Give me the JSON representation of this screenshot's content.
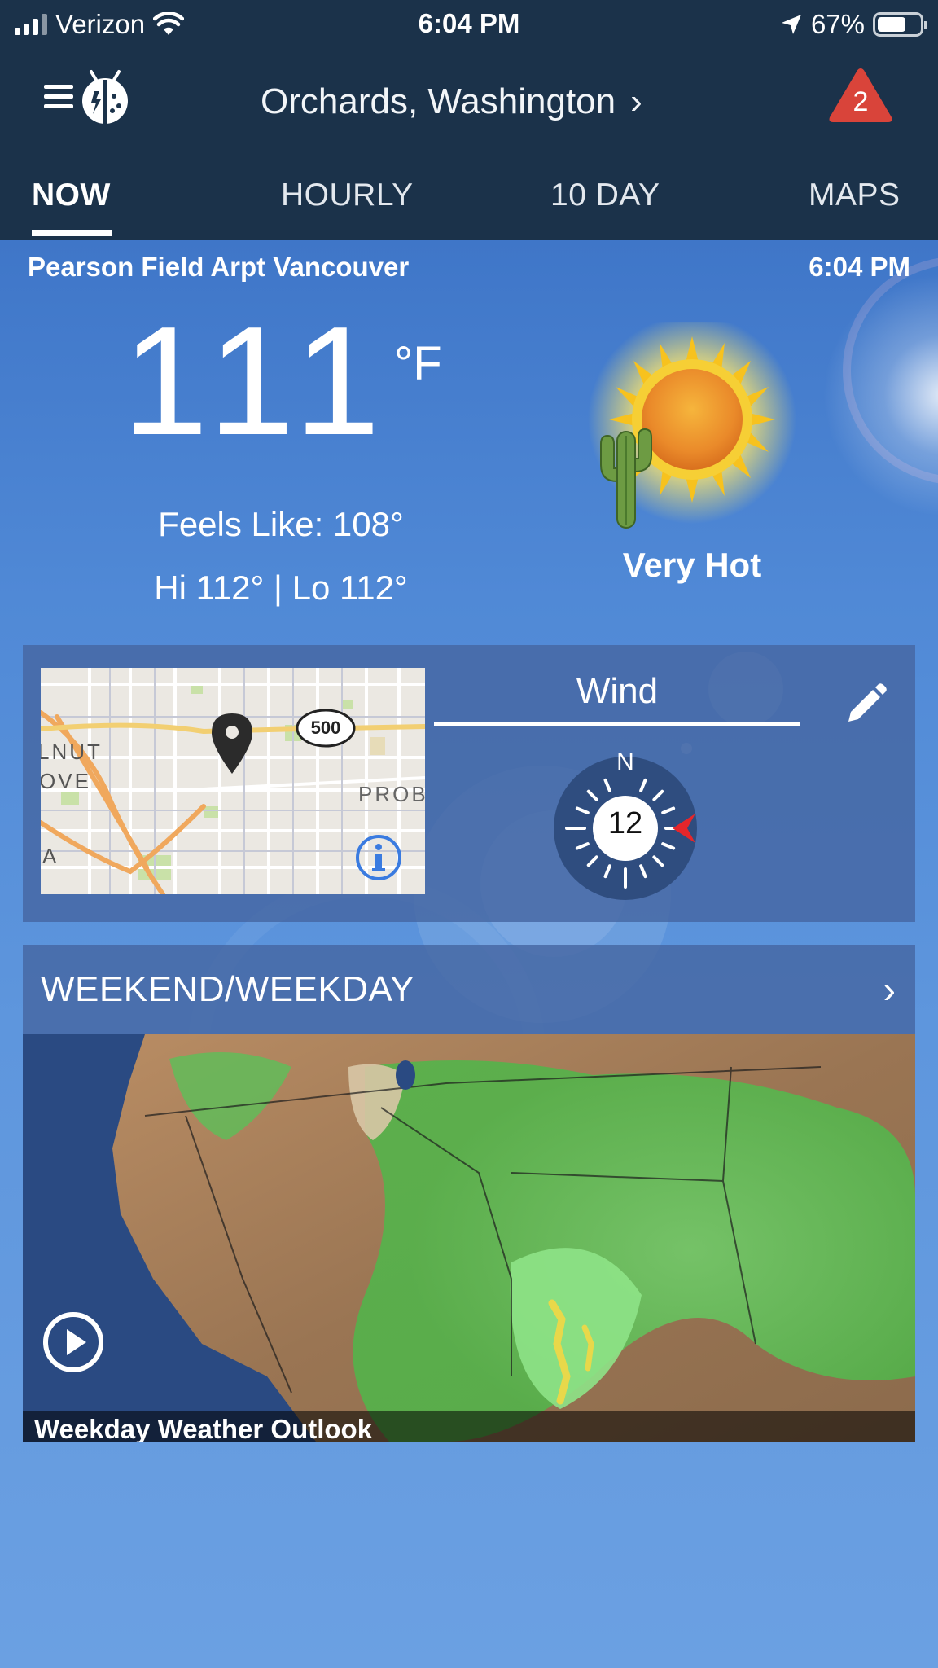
{
  "status_bar": {
    "carrier": "Verizon",
    "time": "6:04 PM",
    "battery": "67%",
    "battery_level": 0.67,
    "icons": [
      "signal-icon",
      "wifi-icon",
      "location-arrow-icon",
      "battery-icon"
    ]
  },
  "header": {
    "location": "Orchards,  Washington",
    "location_chevron": "›",
    "alert_count": "2",
    "alert_color": "#d9443a"
  },
  "tabs": [
    {
      "label": "NOW",
      "active": true
    },
    {
      "label": "HOURLY",
      "active": false
    },
    {
      "label": "10  DAY",
      "active": false
    },
    {
      "label": "MAPS",
      "active": false
    }
  ],
  "current": {
    "station": "Pearson Field Arpt Vancouver",
    "obs_time": "6:04 PM",
    "temperature": "111",
    "unit": "°F",
    "feels_like": "Feels Like: 108°",
    "hi_lo": "Hi 112° | Lo 112°",
    "condition": "Very Hot",
    "condition_icon": "sun-cactus-icon"
  },
  "widget": {
    "map_labels": {
      "walnut": "LNUT",
      "grove": "OVE",
      "a": "A",
      "probst": "PROB",
      "highway_shield": "500"
    },
    "wind_label": "Wind",
    "wind_direction_marker": "N",
    "wind_speed": "12",
    "wind_arrow_color": "#e5262b"
  },
  "video_card": {
    "title": "WEEKEND/WEEKDAY",
    "chevron": "›",
    "caption": "Weekday Weather Outlook"
  }
}
